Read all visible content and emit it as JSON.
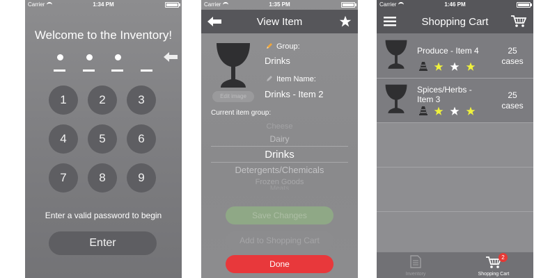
{
  "login": {
    "status": {
      "carrier": "Carrier",
      "time": "1:34 PM"
    },
    "welcome": "Welcome to the Inventory!",
    "keys": [
      "1",
      "2",
      "3",
      "4",
      "5",
      "6",
      "7",
      "8",
      "9"
    ],
    "hint": "Enter a valid password to begin",
    "enter_label": "Enter"
  },
  "view_item": {
    "status": {
      "carrier": "Carrier",
      "time": "1:35 PM"
    },
    "title": "View Item",
    "edit_image_label": "Edit image",
    "group_label": "Group:",
    "group_value": "Drinks",
    "item_name_label": "Item Name:",
    "item_name_value": "Drinks - Item 2",
    "current_group_label": "Current item group:",
    "picker": [
      "Cheese",
      "Dairy",
      "Drinks",
      "Detergents/Chemicals",
      "Frozen Goods",
      "Meats"
    ],
    "picker_selected": "Drinks",
    "save_label": "Save Changes",
    "add_to_cart_label": "Add to Shopping Cart",
    "done_label": "Done",
    "colors": {
      "done": "#e8383b",
      "save": "#8fa886"
    }
  },
  "cart": {
    "status": {
      "carrier": "Carrier",
      "time": "1:46 PM"
    },
    "title": "Shopping Cart",
    "items": [
      {
        "name": "Produce - Item 4",
        "qty": "25",
        "unit": "cases",
        "stars": [
          1,
          0,
          1
        ]
      },
      {
        "name": "Spices/Herbs - Item 3",
        "qty": "25",
        "unit": "cases",
        "stars": [
          1,
          0,
          1
        ]
      }
    ],
    "tabs": [
      {
        "label": "Inventory",
        "icon": "document-icon",
        "active": false
      },
      {
        "label": "Shopping Cart",
        "icon": "cart-icon",
        "active": true,
        "badge": "2"
      }
    ],
    "colors": {
      "star_yellow": "#f0f23c",
      "star_white": "#ffffff"
    }
  }
}
